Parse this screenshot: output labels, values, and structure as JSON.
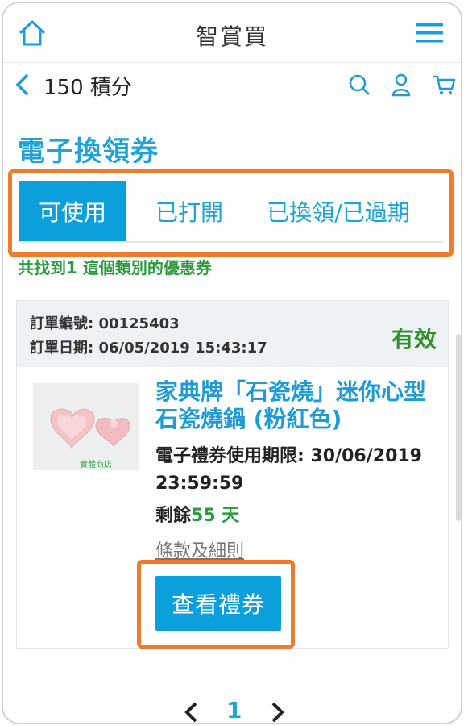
{
  "app": {
    "title": "智賞買"
  },
  "header": {
    "home_icon": "home-icon",
    "menu_icon": "hamburger-menu-icon"
  },
  "subnav": {
    "back_icon": "chevron-left-icon",
    "points_label": "150 積分",
    "search_icon": "search-icon",
    "user_icon": "user-icon",
    "cart_icon": "cart-icon"
  },
  "page": {
    "title": "電子換領券"
  },
  "tabs": [
    {
      "label": "可使用",
      "active": true
    },
    {
      "label": "已打開",
      "active": false
    },
    {
      "label": "已換領/已過期",
      "active": false
    }
  ],
  "result_text": "共找到1 這個類別的優惠券",
  "order": {
    "number_label": "訂單編號: 00125403",
    "date_label": "訂單日期: 06/05/2019 15:43:17",
    "status": "有效",
    "product_name": "家典牌「石瓷燒」迷你心型石瓷燒鍋 (粉紅色)",
    "thumbnail_caption": "實體商店",
    "expiry_label": "電子禮券使用期限: 30/06/2019 23:59:59",
    "remaining_prefix": "剩餘",
    "remaining_days": "55 天",
    "terms_link": "條款及細則",
    "view_button": "查看禮券"
  },
  "pagination": {
    "current": "1",
    "prev_icon": "chevron-left-icon",
    "next_icon": "chevron-right-icon"
  },
  "colors": {
    "accent": "#0b9fdc",
    "highlight": "#f07c2b",
    "success": "#2e9c3e"
  }
}
